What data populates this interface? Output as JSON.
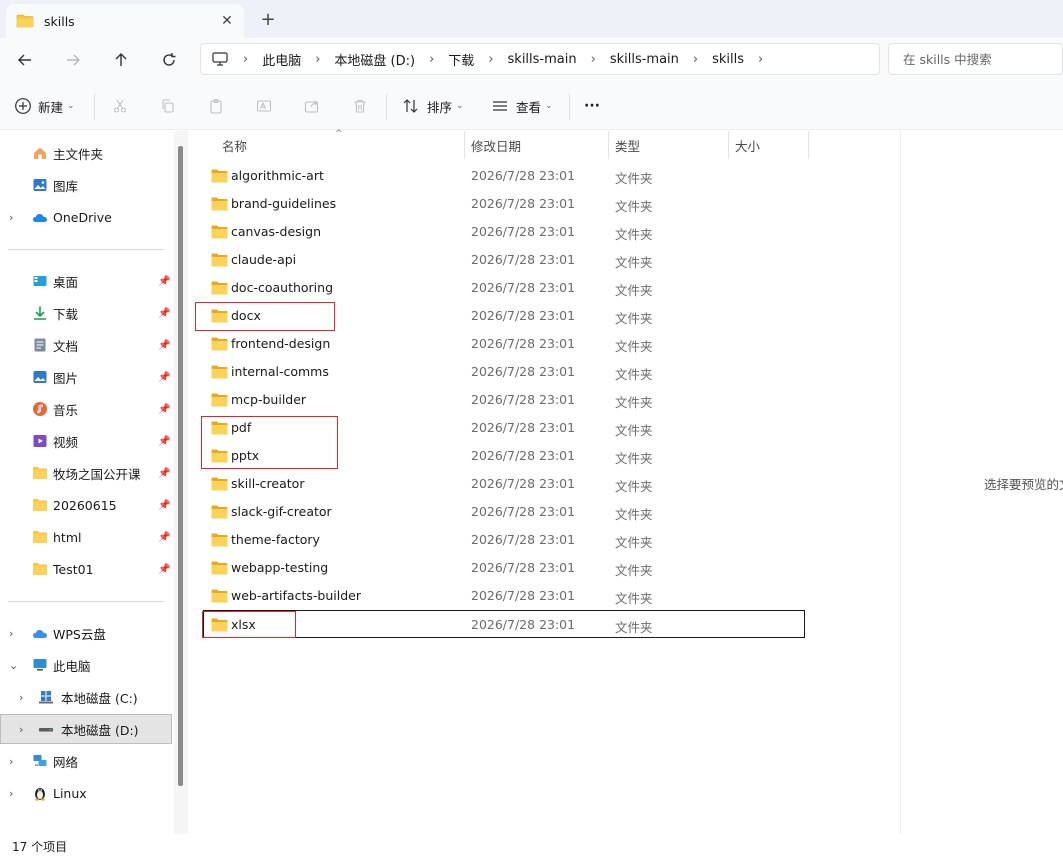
{
  "window": {
    "tab_title": "skills",
    "new_tab_symbol": "+"
  },
  "nav": {
    "breadcrumb": [
      "此电脑",
      "本地磁盘 (D:)",
      "下载",
      "skills-main",
      "skills-main",
      "skills"
    ],
    "search_placeholder": "在 skills 中搜索"
  },
  "toolbar": {
    "new_label": "新建",
    "sort_label": "排序",
    "view_label": "查看",
    "more_label": "···"
  },
  "sidebar": {
    "quick": [
      {
        "label": "主文件夹",
        "icon": "home-icon"
      },
      {
        "label": "图库",
        "icon": "gallery-icon"
      },
      {
        "label": "OneDrive",
        "icon": "cloud-icon"
      }
    ],
    "pinned": [
      {
        "label": "桌面",
        "icon": "desktop-icon"
      },
      {
        "label": "下载",
        "icon": "download-icon"
      },
      {
        "label": "文档",
        "icon": "document-icon"
      },
      {
        "label": "图片",
        "icon": "picture-icon"
      },
      {
        "label": "音乐",
        "icon": "music-icon"
      },
      {
        "label": "视频",
        "icon": "video-icon"
      },
      {
        "label": "牧场之国公开课",
        "icon": "folder-icon"
      },
      {
        "label": "20260615",
        "icon": "folder-icon"
      },
      {
        "label": "html",
        "icon": "folder-icon"
      },
      {
        "label": "Test01",
        "icon": "folder-icon"
      }
    ],
    "drives": [
      {
        "label": "WPS云盘",
        "icon": "wps-cloud-icon"
      },
      {
        "label": "此电脑",
        "icon": "computer-icon"
      },
      {
        "label": "本地磁盘 (C:)",
        "icon": "windows-drive-icon"
      },
      {
        "label": "本地磁盘 (D:)",
        "icon": "drive-icon"
      },
      {
        "label": "网络",
        "icon": "network-icon"
      },
      {
        "label": "Linux",
        "icon": "linux-icon"
      }
    ]
  },
  "columns": {
    "name": "名称",
    "date": "修改日期",
    "type": "类型",
    "size": "大小"
  },
  "files": [
    {
      "name": "algorithmic-art",
      "date": "2026/7/28 23:01",
      "type": "文件夹"
    },
    {
      "name": "brand-guidelines",
      "date": "2026/7/28 23:01",
      "type": "文件夹"
    },
    {
      "name": "canvas-design",
      "date": "2026/7/28 23:01",
      "type": "文件夹"
    },
    {
      "name": "claude-api",
      "date": "2026/7/28 23:01",
      "type": "文件夹"
    },
    {
      "name": "doc-coauthoring",
      "date": "2026/7/28 23:01",
      "type": "文件夹"
    },
    {
      "name": "docx",
      "date": "2026/7/28 23:01",
      "type": "文件夹"
    },
    {
      "name": "frontend-design",
      "date": "2026/7/28 23:01",
      "type": "文件夹"
    },
    {
      "name": "internal-comms",
      "date": "2026/7/28 23:01",
      "type": "文件夹"
    },
    {
      "name": "mcp-builder",
      "date": "2026/7/28 23:01",
      "type": "文件夹"
    },
    {
      "name": "pdf",
      "date": "2026/7/28 23:01",
      "type": "文件夹"
    },
    {
      "name": "pptx",
      "date": "2026/7/28 23:01",
      "type": "文件夹"
    },
    {
      "name": "skill-creator",
      "date": "2026/7/28 23:01",
      "type": "文件夹"
    },
    {
      "name": "slack-gif-creator",
      "date": "2026/7/28 23:01",
      "type": "文件夹"
    },
    {
      "name": "theme-factory",
      "date": "2026/7/28 23:01",
      "type": "文件夹"
    },
    {
      "name": "webapp-testing",
      "date": "2026/7/28 23:01",
      "type": "文件夹"
    },
    {
      "name": "web-artifacts-builder",
      "date": "2026/7/28 23:01",
      "type": "文件夹"
    },
    {
      "name": "xlsx",
      "date": "2026/7/28 23:01",
      "type": "文件夹"
    }
  ],
  "preview": {
    "message": "选择要预览的文"
  },
  "status": {
    "item_count": "17 个项目"
  },
  "colors": {
    "folder": "#f8c73f",
    "highlight_box": "#e0262d",
    "accent": "#0067c0"
  }
}
